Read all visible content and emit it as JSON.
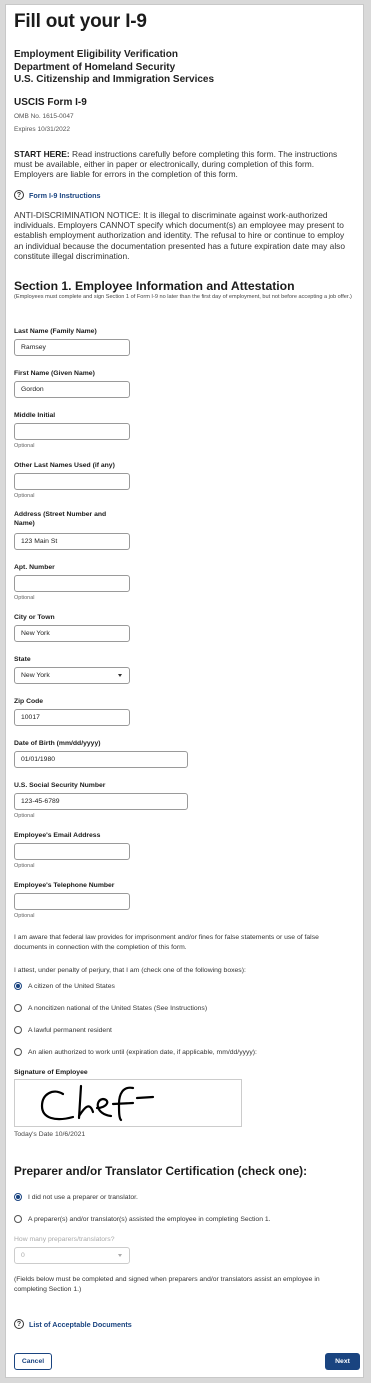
{
  "page": {
    "title": "Fill out your I-9",
    "agency_lines": [
      "Employment Eligibility Verification",
      "Department of Homeland Security",
      "U.S. Citizenship and Immigration Services"
    ],
    "form_name": "USCIS Form I-9",
    "omb": "OMB No. 1615-0047",
    "expires": "Expires 10/31/2022",
    "start_here_bold": "START HERE:",
    "start_here_text": " Read instructions carefully before completing this form. The instructions must be available, either in paper or electronically, during completion of this form. Employers are liable for errors in the completion of this form.",
    "instructions_link": "Form I-9 Instructions",
    "anti_discrimination": "ANTI-DISCRIMINATION NOTICE: It is illegal to discriminate against work-authorized individuals. Employers CANNOT specify which document(s) an employee may present to establish employment authorization and identity. The refusal to hire or continue to employ an individual because the documentation presented has a future expiration date may also constitute illegal discrimination."
  },
  "section1": {
    "heading": "Section 1. Employee Information and Attestation",
    "subheading": "(Employees must complete and sign Section 1 of Form I-9 no later than the first day of employment, but not before accepting a job offer.)",
    "optional_text": "Optional",
    "fields": {
      "last_name": {
        "label": "Last Name (Family Name)",
        "value": "Ramsey"
      },
      "first_name": {
        "label": "First Name (Given Name)",
        "value": "Gordon"
      },
      "middle_initial": {
        "label": "Middle Initial",
        "value": ""
      },
      "other_last_names": {
        "label": "Other Last Names Used (if any)",
        "value": ""
      },
      "address": {
        "label": "Address (Street Number and Name)",
        "value": "123 Main St"
      },
      "apt": {
        "label": "Apt. Number",
        "value": ""
      },
      "city": {
        "label": "City or Town",
        "value": "New York"
      },
      "state": {
        "label": "State",
        "value": "New York"
      },
      "zip": {
        "label": "Zip Code",
        "value": "10017"
      },
      "dob": {
        "label": "Date of Birth (mm/dd/yyyy)",
        "value": "01/01/1980"
      },
      "ssn": {
        "label": "U.S. Social Security Number",
        "value": "123-45-6789"
      },
      "email": {
        "label": "Employee's Email Address",
        "value": ""
      },
      "phone": {
        "label": "Employee's Telephone Number",
        "value": ""
      }
    },
    "awareness": "I am aware that federal law provides for imprisonment and/or fines for false statements or use of false documents in connection with the completion of this form.",
    "attest": "I attest, under penalty of perjury, that I am (check one of the following boxes):",
    "status_options": [
      {
        "label": "A citizen of the United States",
        "selected": true
      },
      {
        "label": "A noncitizen national of the United States (See Instructions)",
        "selected": false
      },
      {
        "label": "A lawful permanent resident",
        "selected": false
      },
      {
        "label": "An alien authorized to work until (expiration date, if applicable, mm/dd/yyyy):",
        "selected": false
      }
    ],
    "signature_label": "Signature of Employee",
    "today_date": "Today's Date 10/6/2021"
  },
  "preparer": {
    "heading": "Preparer and/or Translator Certification (check one):",
    "options": [
      {
        "label": "I did not use a preparer or translator.",
        "selected": true
      },
      {
        "label": "A preparer(s) and/or translator(s) assisted the employee in completing Section 1.",
        "selected": false
      }
    ],
    "count_label": "How many preparers/translators?",
    "count_value": "0",
    "note": "(Fields below must be completed and signed when preparers and/or translators assist an employee in completing Section 1.)",
    "documents_link": "List of Acceptable Documents"
  },
  "actions": {
    "cancel": "Cancel",
    "next": "Next"
  },
  "colors": {
    "accent": "#1a4480",
    "text": "#1b1b1b",
    "border": "#9a9a9a"
  }
}
